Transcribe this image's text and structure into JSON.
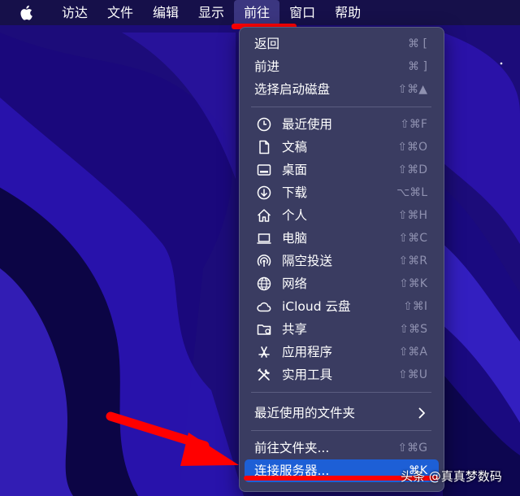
{
  "menubar": {
    "items": [
      "访达",
      "文件",
      "编辑",
      "显示",
      "前往",
      "窗口",
      "帮助"
    ],
    "active_index": 4
  },
  "menu": {
    "items": [
      {
        "label": "返回",
        "shortcut": "⌘ [",
        "icon": ""
      },
      {
        "label": "前进",
        "shortcut": "⌘ ]",
        "icon": ""
      },
      {
        "label": "选择启动磁盘",
        "shortcut": "⇧⌘▲",
        "icon": ""
      },
      {
        "label": "最近使用",
        "shortcut": "⇧⌘F",
        "icon": "clock-icon"
      },
      {
        "label": "文稿",
        "shortcut": "⇧⌘O",
        "icon": "document-icon"
      },
      {
        "label": "桌面",
        "shortcut": "⇧⌘D",
        "icon": "desktop-icon"
      },
      {
        "label": "下载",
        "shortcut": "⌥⌘L",
        "icon": "download-icon"
      },
      {
        "label": "个人",
        "shortcut": "⇧⌘H",
        "icon": "home-icon"
      },
      {
        "label": "电脑",
        "shortcut": "⇧⌘C",
        "icon": "laptop-icon"
      },
      {
        "label": "隔空投送",
        "shortcut": "⇧⌘R",
        "icon": "airdrop-icon"
      },
      {
        "label": "网络",
        "shortcut": "⇧⌘K",
        "icon": "globe-icon"
      },
      {
        "label": "iCloud 云盘",
        "shortcut": "⇧⌘I",
        "icon": "cloud-icon"
      },
      {
        "label": "共享",
        "shortcut": "⇧⌘S",
        "icon": "shared-folder-icon"
      },
      {
        "label": "应用程序",
        "shortcut": "⇧⌘A",
        "icon": "applications-icon"
      },
      {
        "label": "实用工具",
        "shortcut": "⇧⌘U",
        "icon": "tools-icon"
      },
      {
        "label": "最近使用的文件夹",
        "shortcut": "",
        "icon": ""
      },
      {
        "label": "前往文件夹...",
        "shortcut": "⇧⌘G",
        "icon": ""
      },
      {
        "label": "连接服务器...",
        "shortcut": "⌘K",
        "icon": ""
      }
    ]
  },
  "watermark": "头条 @真真梦数码",
  "colors": {
    "highlight": "#1d5fd6",
    "annotation": "#ff0000",
    "menu_bg": "#3a3c61"
  }
}
